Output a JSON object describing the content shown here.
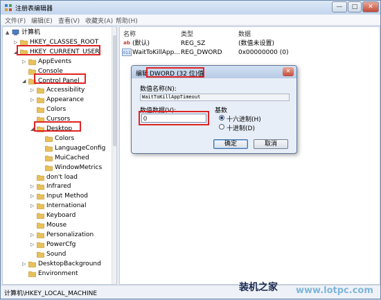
{
  "window": {
    "title": "注册表编辑器"
  },
  "titlebar_buttons": {
    "minimize": "—",
    "maximize": "□",
    "close": "✕"
  },
  "menu": [
    "文件(F)",
    "编辑(E)",
    "查看(V)",
    "收藏夹(A)",
    "帮助(H)"
  ],
  "tree": [
    {
      "label": "计算机",
      "arrow": "▲",
      "level": 0,
      "icon": "computer-icon"
    },
    {
      "label": "HKEY_CLASSES_ROOT",
      "arrow": "▷",
      "level": 1
    },
    {
      "label": "HKEY_CURRENT_USER",
      "arrow": "◢",
      "level": 1,
      "highlight": true
    },
    {
      "label": "AppEvents",
      "arrow": "▷",
      "level": 2
    },
    {
      "label": "Console",
      "arrow": "",
      "level": 2
    },
    {
      "label": "Control Panel",
      "arrow": "◢",
      "level": 2,
      "highlight": true
    },
    {
      "label": "Accessibility",
      "arrow": "▷",
      "level": 3
    },
    {
      "label": "Appearance",
      "arrow": "▷",
      "level": 3
    },
    {
      "label": "Colors",
      "arrow": "",
      "level": 3
    },
    {
      "label": "Cursors",
      "arrow": "",
      "level": 3
    },
    {
      "label": "Desktop",
      "arrow": "◢",
      "level": 3,
      "highlight": true
    },
    {
      "label": "Colors",
      "arrow": "",
      "level": 4
    },
    {
      "label": "LanguageConfig",
      "arrow": "",
      "level": 4
    },
    {
      "label": "MuiCached",
      "arrow": "",
      "level": 4
    },
    {
      "label": "WindowMetrics",
      "arrow": "",
      "level": 4
    },
    {
      "label": "don't load",
      "arrow": "",
      "level": 3
    },
    {
      "label": "Infrared",
      "arrow": "▷",
      "level": 3
    },
    {
      "label": "Input Method",
      "arrow": "▷",
      "level": 3
    },
    {
      "label": "International",
      "arrow": "▷",
      "level": 3
    },
    {
      "label": "Keyboard",
      "arrow": "",
      "level": 3
    },
    {
      "label": "Mouse",
      "arrow": "",
      "level": 3
    },
    {
      "label": "Personalization",
      "arrow": "▷",
      "level": 3
    },
    {
      "label": "PowerCfg",
      "arrow": "▷",
      "level": 3
    },
    {
      "label": "Sound",
      "arrow": "",
      "level": 3
    },
    {
      "label": "DesktopBackground",
      "arrow": "▷",
      "level": 2
    },
    {
      "label": "Environment",
      "arrow": "",
      "level": 2
    }
  ],
  "list": {
    "headers": {
      "name": "名称",
      "type": "类型",
      "data": "数据"
    },
    "rows": [
      {
        "icon": "ab",
        "name": "(默认)",
        "type": "REG_SZ",
        "data": "(数值未设置)"
      },
      {
        "icon": "011",
        "name": "WaitToKillApp...",
        "type": "REG_DWORD",
        "data": "0x00000000 (0)"
      }
    ]
  },
  "status": {
    "path": "计算机\\HKEY_LOCAL_MACHINE"
  },
  "dialog": {
    "title_prefix": "编辑",
    "title_main": "DWORD (32 位)值",
    "close": "✕",
    "name_label": "数值名称(N):",
    "name_value": "WaitToKillAppTimeout",
    "data_label": "数值数据(V):",
    "data_value": "0",
    "base_label": "基数",
    "base_hex": "十六进制(H)",
    "base_dec": "十进制(D)",
    "ok": "确定",
    "cancel": "取消"
  },
  "watermark": {
    "text": "装机之家",
    "sub": "www.lotpc.com"
  },
  "colors": {
    "highlight": "#e02222",
    "folder": "#e8c15a"
  }
}
